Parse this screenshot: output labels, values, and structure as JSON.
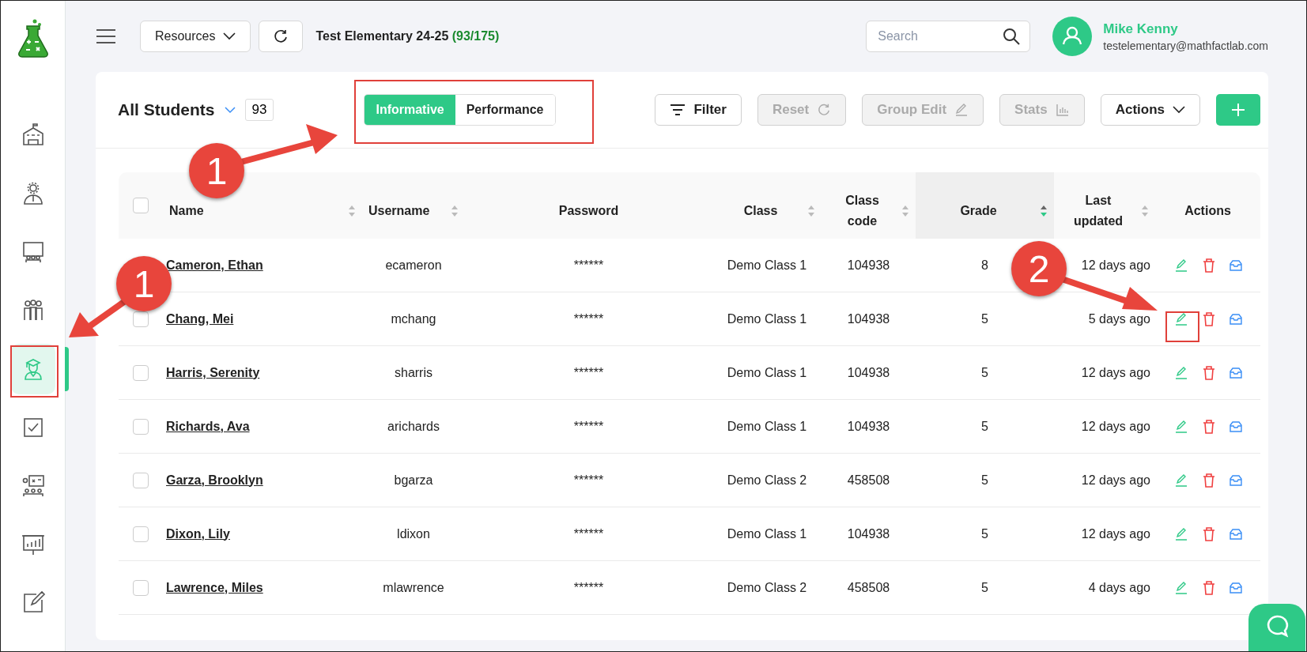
{
  "sidebar": {
    "items": [
      {
        "kind": "school",
        "selected": false
      },
      {
        "kind": "admin",
        "selected": false
      },
      {
        "kind": "classroom",
        "selected": false
      },
      {
        "kind": "group",
        "selected": false
      },
      {
        "kind": "student",
        "selected": true
      },
      {
        "kind": "checklist",
        "selected": false
      },
      {
        "kind": "board",
        "selected": false
      },
      {
        "kind": "report",
        "selected": false
      },
      {
        "kind": "edit",
        "selected": false
      }
    ]
  },
  "topbar": {
    "resources_label": "Resources",
    "title": "Test Elementary 24-25",
    "title_count": "(93/175)",
    "search": {
      "placeholder": "Search"
    },
    "user": {
      "name": "Mike Kenny",
      "email": "testelementary@mathfactlab.com"
    }
  },
  "toolbar": {
    "list_label": "All Students",
    "count": "93",
    "view_tabs": [
      {
        "label": "Informative",
        "selected": true
      },
      {
        "label": "Performance",
        "selected": false
      }
    ],
    "buttons": [
      {
        "label": "Filter",
        "disabled": false,
        "kind": "filter"
      },
      {
        "label": "Reset",
        "disabled": true,
        "kind": "refresh"
      },
      {
        "label": "Group Edit",
        "disabled": true,
        "kind": "pencil"
      },
      {
        "label": "Stats",
        "disabled": true,
        "kind": "chart"
      },
      {
        "label": "Actions",
        "disabled": false,
        "kind": "dropdown"
      }
    ]
  },
  "table": {
    "header_checked": false,
    "columns": [
      {
        "label": "Name",
        "kind": "sortable",
        "selected": false
      },
      {
        "label": "Username",
        "kind": "sortable",
        "selected": false
      },
      {
        "label": "Password",
        "kind": "plain"
      },
      {
        "label": "Class",
        "kind": "sortable",
        "selected": false
      },
      {
        "label": "Class code",
        "kind": "sortable",
        "selected": false
      },
      {
        "label": "Grade",
        "kind": "sortable",
        "selected": true
      },
      {
        "label": "Last updated",
        "kind": "sortable",
        "selected": false
      },
      {
        "label": "Actions",
        "kind": "plain"
      }
    ],
    "rows": [
      {
        "name": "Cameron, Ethan",
        "username": "ecameron",
        "password": "******",
        "class": "Demo Class 1",
        "class_code": "104938",
        "grade": "8",
        "last_updated": "12 days ago"
      },
      {
        "checked": false,
        "name": "Chang, Mei",
        "username": "mchang",
        "password": "******",
        "class": "Demo Class 1",
        "class_code": "104938",
        "grade": "5",
        "last_updated": "5 days ago"
      },
      {
        "checked": false,
        "name": "Harris, Serenity",
        "username": "sharris",
        "password": "******",
        "class": "Demo Class 1",
        "class_code": "104938",
        "grade": "5",
        "last_updated": "12 days ago"
      },
      {
        "checked": false,
        "name": "Richards, Ava",
        "username": "arichards",
        "password": "******",
        "class": "Demo Class 1",
        "class_code": "104938",
        "grade": "5",
        "last_updated": "12 days ago"
      },
      {
        "checked": false,
        "name": "Garza, Brooklyn",
        "username": "bgarza",
        "password": "******",
        "class": "Demo Class 2",
        "class_code": "458508",
        "grade": "5",
        "last_updated": "12 days ago"
      },
      {
        "checked": false,
        "name": "Dixon, Lily",
        "username": "ldixon",
        "password": "******",
        "class": "Demo Class 1",
        "class_code": "104938",
        "grade": "5",
        "last_updated": "12 days ago"
      },
      {
        "checked": false,
        "name": "Lawrence, Miles",
        "username": "mlawrence",
        "password": "******",
        "class": "Demo Class 2",
        "class_code": "458508",
        "grade": "5",
        "last_updated": "4 days ago"
      }
    ]
  },
  "annotations": [
    {
      "kind": "badge",
      "label": "1"
    },
    {
      "kind": "badge",
      "label": "1"
    },
    {
      "kind": "badge",
      "label": "2"
    }
  ]
}
